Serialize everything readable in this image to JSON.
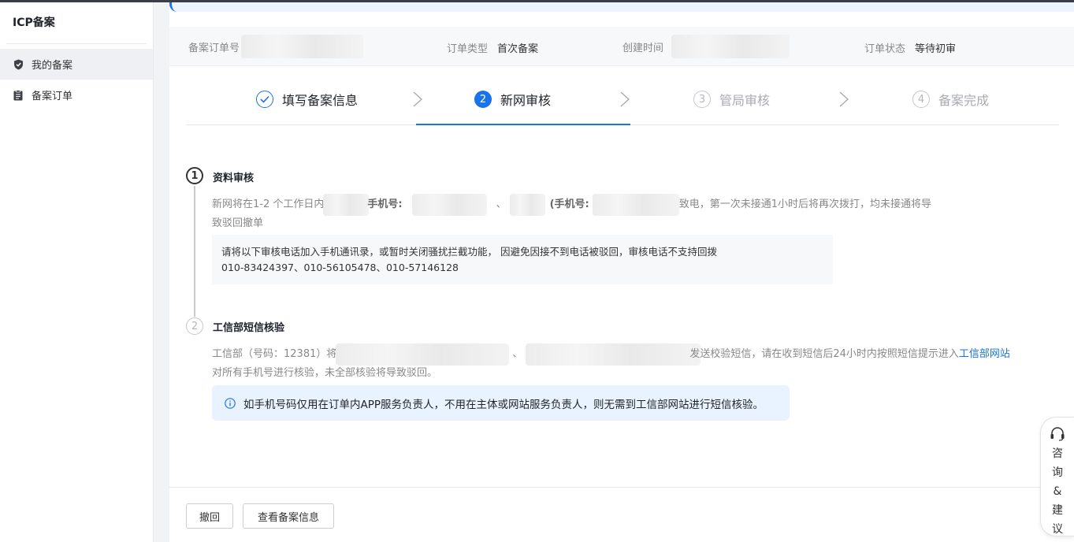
{
  "sidebar": {
    "brand": "ICP备案",
    "items": [
      {
        "label": "我的备案",
        "icon": "shield-icon",
        "active": true
      },
      {
        "label": "备案订单",
        "icon": "clipboard-icon",
        "active": false
      }
    ]
  },
  "order_info": {
    "order_no_label": "备案订单号",
    "order_type_label": "订单类型",
    "order_type_value": "首次备案",
    "created_label": "创建时间",
    "status_label": "订单状态",
    "status_value": "等待初审"
  },
  "steps": [
    {
      "num": "1",
      "label": "填写备案信息",
      "state": "done"
    },
    {
      "num": "2",
      "label": "新网审核",
      "state": "active"
    },
    {
      "num": "3",
      "label": "管局审核",
      "state": "todo"
    },
    {
      "num": "4",
      "label": "备案完成",
      "state": "todo"
    }
  ],
  "section1": {
    "num": "1",
    "title": "资料审核",
    "desc_a": "新网将在1-2 个工作日内给",
    "desc_b": "手机号:",
    "desc_c": "、",
    "desc_d": "(手机号:",
    "desc_e": "致电，第一次未接通1小时后将再次拨打，均未接通将导",
    "desc_f": "致驳回撤单",
    "phone_box_line1": "请将以下审核电话加入手机通讯录，或暂时关闭骚扰拦截功能， 因避免因接不到电话被驳回，审核电话不支持回拨",
    "phone_box_line2": "010-83424397、010-56105478、010-57146128"
  },
  "section2": {
    "num": "2",
    "title": "工信部短信核验",
    "desc_a": "工信部（号码：12381）将给",
    "desc_b": "、",
    "desc_c": "发送校验短信，请在收到短信后24小时内按照短信提示进入",
    "link": "工信部网站",
    "desc_d": "对所有手机号进行核验，未全部核验将导致驳回。",
    "tip": "如手机号码仅用在订单内APP服务负责人，不用在主体或网站服务负责人，则无需到工信部网站进行短信核验。"
  },
  "footer": {
    "withdraw": "撤回",
    "view_info": "查看备案信息"
  },
  "consult": {
    "chars": [
      "咨",
      "询",
      "&",
      "建",
      "议"
    ]
  },
  "colors": {
    "primary": "#1a73e8",
    "tip_bg": "#e8f3ff"
  }
}
